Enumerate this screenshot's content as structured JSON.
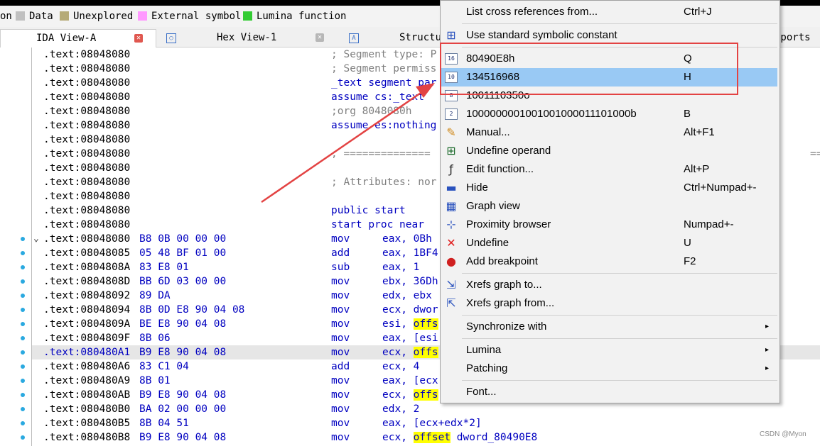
{
  "legend": [
    {
      "label": "on",
      "color": ""
    },
    {
      "label": "Data",
      "color": "#c0c0c0"
    },
    {
      "label": "Unexplored",
      "color": "#b5aa77"
    },
    {
      "label": "External symbol",
      "color": "#ff99ff"
    },
    {
      "label": "Lumina function",
      "color": "#33cc33"
    }
  ],
  "tabs": [
    {
      "label": "IDA View-A",
      "active": true
    },
    {
      "label": "Hex View-1",
      "active": false
    },
    {
      "label": "Structu",
      "active": false
    },
    {
      "label": "mports",
      "active": false
    }
  ],
  "listing": {
    "simple_rows": [
      {
        "addr": ".text:08048080",
        "text": "; Segment type: P",
        "kind": "cmt"
      },
      {
        "addr": ".text:08048080",
        "text": "; Segment permiss",
        "kind": "cmt"
      },
      {
        "addr": ".text:08048080",
        "text": "_text segment par",
        "kind": "dir"
      },
      {
        "addr": ".text:08048080",
        "text": "assume cs:_text",
        "kind": "dir"
      },
      {
        "addr": ".text:08048080",
        "text": ";org 8048080h",
        "kind": "cmt"
      },
      {
        "addr": ".text:08048080",
        "text": "assume es:nothing",
        "kind": "dir"
      },
      {
        "addr": ".text:08048080",
        "text": "",
        "kind": "cmt"
      },
      {
        "addr": ".text:08048080",
        "text": "; ==============",
        "kind": "cmt"
      },
      {
        "addr": ".text:08048080",
        "text": "",
        "kind": "cmt"
      },
      {
        "addr": ".text:08048080",
        "text": "; Attributes: nor",
        "kind": "cmt"
      },
      {
        "addr": ".text:08048080",
        "text": "",
        "kind": "cmt"
      },
      {
        "addr": ".text:08048080",
        "text": "public start",
        "kind": "dir"
      },
      {
        "addr": ".text:08048080",
        "text": "start proc near",
        "kind": "dir"
      }
    ],
    "eq_tail": "=======",
    "code_rows": [
      {
        "addr": ".text:08048080",
        "bytes": "B8 0B 00 00 00",
        "mn": "mov",
        "op": "eax, 0Bh",
        "yellow": ""
      },
      {
        "addr": ".text:08048085",
        "bytes": "05 48 BF 01 00",
        "mn": "add",
        "op": "eax, 1BF4",
        "yellow": ""
      },
      {
        "addr": ".text:0804808A",
        "bytes": "83 E8 01",
        "mn": "sub",
        "op": "eax, 1",
        "yellow": ""
      },
      {
        "addr": ".text:0804808D",
        "bytes": "BB 6D 03 00 00",
        "mn": "mov",
        "op": "ebx, 36Dh",
        "yellow": ""
      },
      {
        "addr": ".text:08048092",
        "bytes": "89 DA",
        "mn": "mov",
        "op": "edx, ebx",
        "yellow": ""
      },
      {
        "addr": ".text:08048094",
        "bytes": "8B 0D E8 90 04 08",
        "mn": "mov",
        "op": "ecx, dwor",
        "yellow": ""
      },
      {
        "addr": ".text:0804809A",
        "bytes": "BE E8 90 04 08",
        "mn": "mov",
        "op": "esi, ",
        "yellow": "offs"
      },
      {
        "addr": ".text:0804809F",
        "bytes": "8B 06",
        "mn": "mov",
        "op": "eax, [esi",
        "yellow": ""
      },
      {
        "addr": ".text:080480A1",
        "bytes": "B9 E8 90 04 08",
        "mn": "mov",
        "op": "ecx, ",
        "yellow": "offs"
      },
      {
        "addr": ".text:080480A6",
        "bytes": "83 C1 04",
        "mn": "add",
        "op": "ecx, 4",
        "yellow": ""
      },
      {
        "addr": ".text:080480A9",
        "bytes": "8B 01",
        "mn": "mov",
        "op": "eax, [ecx",
        "yellow": ""
      },
      {
        "addr": ".text:080480AB",
        "bytes": "B9 E8 90 04 08",
        "mn": "mov",
        "op": "ecx, ",
        "yellow": "offs"
      },
      {
        "addr": ".text:080480B0",
        "bytes": "BA 02 00 00 00",
        "mn": "mov",
        "op": "edx, 2",
        "yellow": ""
      },
      {
        "addr": ".text:080480B5",
        "bytes": "8B 04 51",
        "mn": "mov",
        "op": "eax, [ecx+edx*2]",
        "yellow": ""
      },
      {
        "addr": ".text:080480B8",
        "bytes": "B9 E8 90 04 08",
        "mn": "mov",
        "op": "ecx, ",
        "yellow": "offset",
        "tail": " dword_80490E8"
      }
    ]
  },
  "context_menu": {
    "items": [
      {
        "label": "List cross references from...",
        "key": "Ctrl+J",
        "icon": "none",
        "arrow": false,
        "selected": false,
        "sep_after": true
      },
      {
        "label": "Use standard symbolic constant",
        "key": "",
        "icon": "symbolic-constant-icon",
        "arrow": false,
        "selected": false,
        "sep_after": true
      },
      {
        "label": "80490E8h",
        "key": "Q",
        "icon": "hex-16-icon",
        "icon_text": "16",
        "arrow": false,
        "selected": false,
        "sep_after": false
      },
      {
        "label": "134516968",
        "key": "H",
        "icon": "decimal-10-icon",
        "icon_text": "10",
        "arrow": false,
        "selected": true,
        "sep_after": false
      },
      {
        "label": "1001110350o",
        "key": "",
        "icon": "octal-8-icon",
        "icon_text": "8",
        "arrow": false,
        "selected": false,
        "sep_after": false
      },
      {
        "label": "1000000001001001000011101000b",
        "key": "B",
        "icon": "binary-2-icon",
        "icon_text": "2",
        "arrow": false,
        "selected": false,
        "sep_after": false
      },
      {
        "label": "Manual...",
        "key": "Alt+F1",
        "icon": "pencil-icon",
        "arrow": false,
        "selected": false,
        "sep_after": false
      },
      {
        "label": "Undefine operand",
        "key": "",
        "icon": "undefine-operand-icon",
        "arrow": false,
        "selected": false,
        "sep_after": false
      },
      {
        "label": "Edit function...",
        "key": "Alt+P",
        "icon": "function-f-icon",
        "arrow": false,
        "selected": false,
        "sep_after": false
      },
      {
        "label": "Hide",
        "key": "Ctrl+Numpad+-",
        "icon": "minus-icon",
        "arrow": false,
        "selected": false,
        "sep_after": false
      },
      {
        "label": "Graph view",
        "key": "",
        "icon": "graph-view-icon",
        "arrow": false,
        "selected": false,
        "sep_after": false
      },
      {
        "label": "Proximity browser",
        "key": "Numpad+-",
        "icon": "proximity-icon",
        "arrow": false,
        "selected": false,
        "sep_after": false
      },
      {
        "label": "Undefine",
        "key": "U",
        "icon": "red-x-icon",
        "arrow": false,
        "selected": false,
        "sep_after": false
      },
      {
        "label": "Add breakpoint",
        "key": "F2",
        "icon": "breakpoint-icon",
        "arrow": false,
        "selected": false,
        "sep_after": true
      },
      {
        "label": "Xrefs graph to...",
        "key": "",
        "icon": "xrefs-to-icon",
        "arrow": false,
        "selected": false,
        "sep_after": false
      },
      {
        "label": "Xrefs graph from...",
        "key": "",
        "icon": "xrefs-from-icon",
        "arrow": false,
        "selected": false,
        "sep_after": true
      },
      {
        "label": "Synchronize with",
        "key": "",
        "icon": "none",
        "arrow": true,
        "selected": false,
        "sep_after": true
      },
      {
        "label": "Lumina",
        "key": "",
        "icon": "none",
        "arrow": true,
        "selected": false,
        "sep_after": false
      },
      {
        "label": "Patching",
        "key": "",
        "icon": "none",
        "arrow": true,
        "selected": false,
        "sep_after": true
      },
      {
        "label": "Font...",
        "key": "",
        "icon": "none",
        "arrow": false,
        "selected": false,
        "sep_after": false
      }
    ]
  },
  "colors": {
    "selection": "#99c9f4",
    "highlight_box": "#e34343",
    "arrow": "#e34343",
    "code_blue": "#0000c0",
    "comment_gray": "#808080",
    "yellow_highlight": "#ffff00"
  },
  "watermark": "CSDN @Myon⁠",
  "arrow_symbol": "▸"
}
